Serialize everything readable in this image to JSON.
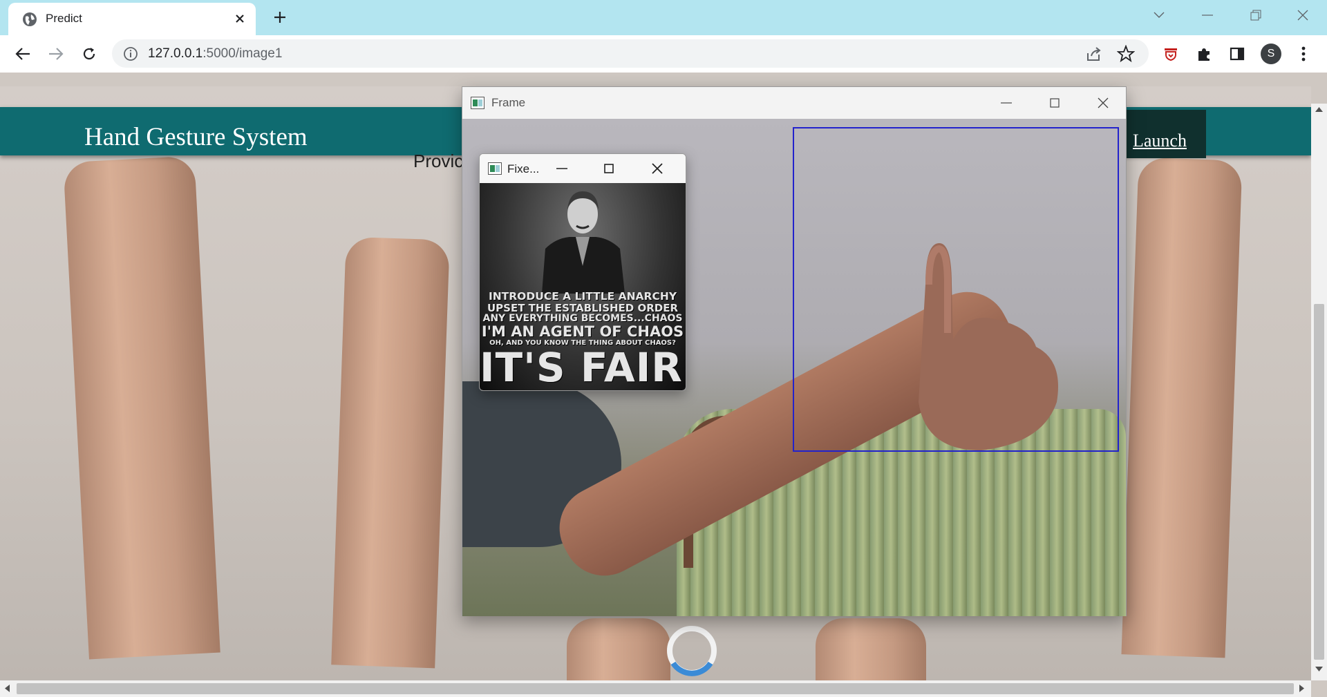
{
  "browser": {
    "tab": {
      "title": "Predict",
      "favicon": "globe-icon",
      "close_icon": "close-icon"
    },
    "new_tab_icon": "plus-icon",
    "window_controls": [
      "chevron-down-icon",
      "minimize-icon",
      "restore-icon",
      "close-icon"
    ],
    "nav": {
      "back_icon": "arrow-left-icon",
      "forward_icon": "arrow-right-icon",
      "reload_icon": "reload-icon"
    },
    "omnibox": {
      "host": "127.0.0.1",
      "rest": ":5000/image1",
      "info_icon": "info-icon",
      "share_icon": "share-icon",
      "bookmark_icon": "star-icon"
    },
    "extensions": [
      "extension-shield-icon",
      "puzzle-icon",
      "sidepanel-icon"
    ],
    "profile_initial": "S",
    "menu_icon": "kebab-menu-icon"
  },
  "page": {
    "site_title": "Hand Gesture System",
    "launch_label": "Launch",
    "partial_text": "Provic",
    "header_color": "#0f6b70",
    "loading_spinner": "spinner-icon"
  },
  "frame_window": {
    "title": "Frame",
    "icon": "opencv-window-icon",
    "controls": [
      "minimize-icon",
      "maximize-icon",
      "close-icon"
    ],
    "roi_color": "#2222cc"
  },
  "fixed_window": {
    "title": "Fixe...",
    "icon": "opencv-window-icon",
    "controls": [
      "minimize-icon",
      "maximize-icon",
      "close-icon"
    ],
    "poster_lines": [
      "INTRODUCE A LITTLE ANARCHY",
      "UPSET THE ESTABLISHED ORDER",
      "ANY EVERYTHING BECOMES...CHAOS",
      "I'M AN AGENT OF CHAOS",
      "OH, AND YOU KNOW THE THING ABOUT CHAOS?",
      "IT'S FAIR!"
    ]
  }
}
